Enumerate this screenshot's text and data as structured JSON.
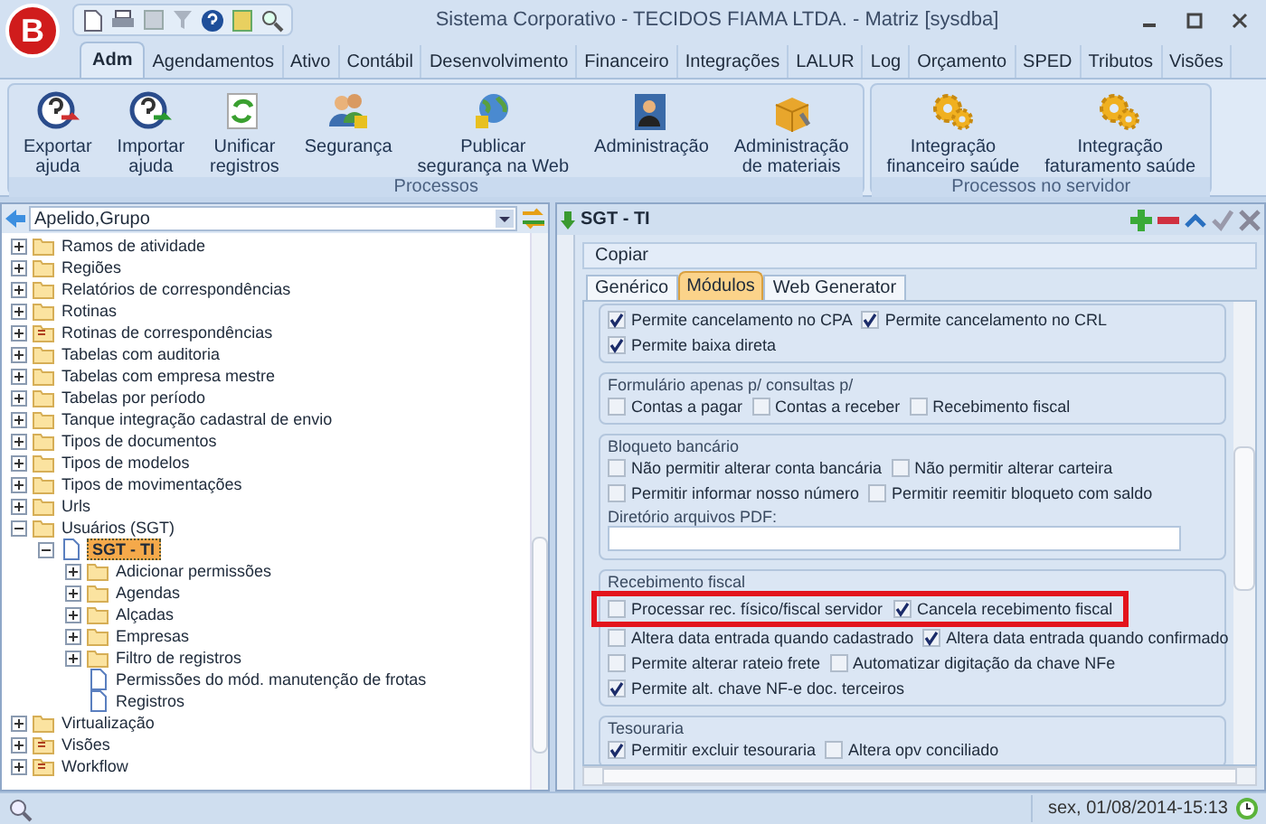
{
  "window": {
    "title": "Sistema Corporativo - TECIDOS FIAMA LTDA. - Matriz [sysdba]",
    "logo": "B"
  },
  "ribbon": {
    "tabs": [
      {
        "label": "Adm",
        "selected": true
      },
      {
        "label": "Agendamentos",
        "selected": false
      },
      {
        "label": "Ativo",
        "selected": false
      },
      {
        "label": "Contábil",
        "selected": false
      },
      {
        "label": "Desenvolvimento",
        "selected": false
      },
      {
        "label": "Financeiro",
        "selected": false
      },
      {
        "label": "Integrações",
        "selected": false
      },
      {
        "label": "LALUR",
        "selected": false
      },
      {
        "label": "Log",
        "selected": false
      },
      {
        "label": "Orçamento",
        "selected": false
      },
      {
        "label": "SPED",
        "selected": false
      },
      {
        "label": "Tributos",
        "selected": false
      },
      {
        "label": "Visões",
        "selected": false
      }
    ],
    "groups": [
      {
        "title": "Processos",
        "buttons": [
          {
            "label": "Exportar\najuda",
            "kind": "help-export"
          },
          {
            "label": "Importar\najuda",
            "kind": "help-import"
          },
          {
            "label": "Unificar\nregistros",
            "kind": "merge"
          },
          {
            "label": "Segurança",
            "kind": "users"
          },
          {
            "label": "Publicar\nsegurança na Web",
            "kind": "globe"
          },
          {
            "label": "Administração",
            "kind": "admin"
          },
          {
            "label": "Administração\nde materiais",
            "kind": "box"
          }
        ]
      },
      {
        "title": "Processos no servidor",
        "buttons": [
          {
            "label": "Integração\nfinanceiro saúde",
            "kind": "gears"
          },
          {
            "label": "Integração\nfaturamento saúde",
            "kind": "gears"
          }
        ]
      }
    ]
  },
  "sidebar": {
    "filter": "Apelido,Grupo",
    "tree": [
      {
        "label": "Ramos de atividade",
        "kind": "folder",
        "expanded": false,
        "selected": false
      },
      {
        "label": "Regiões",
        "kind": "folder",
        "expanded": false,
        "selected": false
      },
      {
        "label": "Relatórios de correspondências",
        "kind": "folder",
        "expanded": false,
        "selected": false
      },
      {
        "label": "Rotinas",
        "kind": "folder",
        "expanded": false,
        "selected": false
      },
      {
        "label": "Rotinas de correspondências",
        "kind": "report",
        "expanded": false,
        "selected": false
      },
      {
        "label": "Tabelas com auditoria",
        "kind": "folder",
        "expanded": false,
        "selected": false
      },
      {
        "label": "Tabelas com empresa mestre",
        "kind": "folder",
        "expanded": false,
        "selected": false
      },
      {
        "label": "Tabelas por período",
        "kind": "folder",
        "expanded": false,
        "selected": false
      },
      {
        "label": "Tanque integração cadastral de envio",
        "kind": "folder",
        "expanded": false,
        "selected": false
      },
      {
        "label": "Tipos de documentos",
        "kind": "folder",
        "expanded": false,
        "selected": false
      },
      {
        "label": "Tipos de modelos",
        "kind": "folder",
        "expanded": false,
        "selected": false
      },
      {
        "label": "Tipos de movimentações",
        "kind": "folder",
        "expanded": false,
        "selected": false
      },
      {
        "label": "Urls",
        "kind": "folder",
        "expanded": false,
        "selected": false
      },
      {
        "label": "Usuários (SGT)",
        "kind": "folder",
        "expanded": true,
        "selected": false,
        "children": [
          {
            "label": "SGT - TI",
            "kind": "document",
            "expanded": true,
            "selected": true,
            "children": [
              {
                "label": "Adicionar permissões",
                "kind": "folder",
                "expanded": false,
                "selected": false
              },
              {
                "label": "Agendas",
                "kind": "folder",
                "expanded": false,
                "selected": false
              },
              {
                "label": "Alçadas",
                "kind": "folder",
                "expanded": false,
                "selected": false
              },
              {
                "label": "Empresas",
                "kind": "folder",
                "expanded": false,
                "selected": false
              },
              {
                "label": "Filtro de registros",
                "kind": "folder",
                "expanded": false,
                "selected": false
              },
              {
                "label": "Permissões do mód. manutenção de frotas",
                "kind": "document",
                "selected": false
              },
              {
                "label": "Registros",
                "kind": "document",
                "selected": false
              }
            ]
          }
        ]
      },
      {
        "label": "Virtualização",
        "kind": "folder",
        "expanded": false,
        "selected": false
      },
      {
        "label": "Visões",
        "kind": "report",
        "expanded": false,
        "selected": false
      },
      {
        "label": "Workflow",
        "kind": "report",
        "expanded": false,
        "selected": false
      }
    ]
  },
  "detail": {
    "title": "SGT - TI",
    "toolbar": "Copiar",
    "tabs": [
      {
        "label": "Genérico",
        "selected": false
      },
      {
        "label": "Módulos",
        "selected": true
      },
      {
        "label": "Web Generator",
        "selected": false
      }
    ],
    "groups": [
      {
        "rows": [
          {
            "items": [
              {
                "label": "Permite cancelamento no CPA",
                "checked": true
              },
              {
                "label": "Permite cancelamento no CRL",
                "checked": true
              }
            ]
          },
          {
            "items": [
              {
                "label": "Permite baixa direta",
                "checked": true
              }
            ]
          }
        ]
      },
      {
        "title": "Formulário apenas p/ consultas p/",
        "rows": [
          {
            "items": [
              {
                "label": "Contas a pagar",
                "checked": false
              },
              {
                "label": "Contas a receber",
                "checked": false
              },
              {
                "label": "Recebimento fiscal",
                "checked": false
              }
            ]
          }
        ]
      },
      {
        "title": "Bloqueto bancário",
        "rows": [
          {
            "items": [
              {
                "label": "Não permitir alterar conta bancária",
                "checked": false
              },
              {
                "label": "Não permitir alterar carteira",
                "checked": false
              }
            ]
          },
          {
            "items": [
              {
                "label": "Permitir informar nosso número",
                "checked": false
              },
              {
                "label": "Permitir reemitir bloqueto com saldo",
                "checked": false
              }
            ]
          }
        ],
        "field": {
          "label": "Diretório arquivos PDF:"
        }
      },
      {
        "title": "Recebimento fiscal",
        "rows": [
          {
            "highlight": true,
            "items": [
              {
                "label": "Processar rec. físico/fiscal servidor",
                "checked": false
              },
              {
                "label": "Cancela recebimento fiscal",
                "checked": true
              }
            ]
          },
          {
            "items": [
              {
                "label": "Altera data entrada quando cadastrado",
                "checked": false
              },
              {
                "label": "Altera data entrada quando confirmado",
                "checked": true
              }
            ]
          },
          {
            "items": [
              {
                "label": "Permite alterar rateio frete",
                "checked": false
              },
              {
                "label": "Automatizar digitação da chave NFe",
                "checked": false
              }
            ]
          },
          {
            "items": [
              {
                "label": "Permite alt. chave NF-e doc. terceiros",
                "checked": true
              }
            ]
          }
        ]
      },
      {
        "title": "Tesouraria",
        "rows": [
          {
            "items": [
              {
                "label": "Permitir excluir tesouraria",
                "checked": true
              },
              {
                "label": "Altera opv conciliado",
                "checked": false
              }
            ]
          }
        ]
      }
    ]
  },
  "status_bar": {
    "datetime": "sex, 01/08/2014-15:13"
  }
}
